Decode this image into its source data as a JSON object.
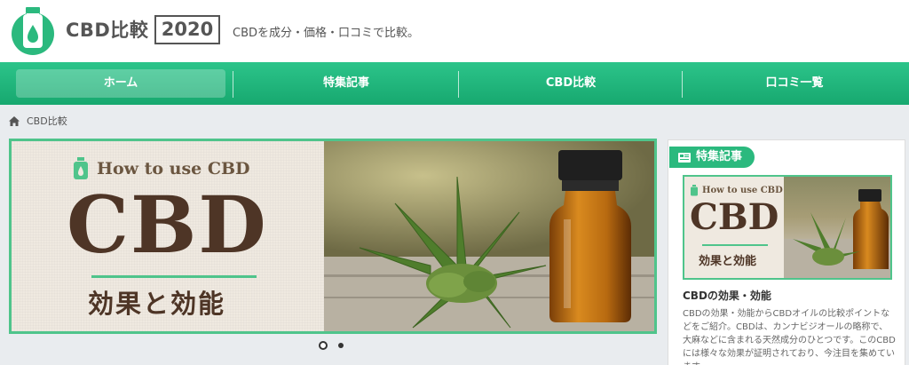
{
  "header": {
    "logo_text": "CBD比較",
    "logo_year": "2020",
    "tagline": "CBDを成分・価格・口コミで比較。"
  },
  "nav": {
    "items": [
      {
        "label": "ホーム",
        "active": true
      },
      {
        "label": "特集記事",
        "active": false
      },
      {
        "label": "CBD比較",
        "active": false
      },
      {
        "label": "口コミ一覧",
        "active": false
      }
    ]
  },
  "breadcrumb": {
    "home_icon": "home-icon",
    "label": "CBD比較"
  },
  "slider": {
    "how_to": "How to use CBD",
    "big_title": "CBD",
    "subtitle": "効果と効能",
    "dots": 2,
    "active_dot": 0
  },
  "sidebar": {
    "section_label": "特集記事",
    "section_icon": "newspaper-icon",
    "thumb": {
      "how_to": "How to use CBD",
      "big_title": "CBD",
      "subtitle": "効果と効能"
    },
    "article_title": "CBDの効果・効能",
    "article_excerpt": "CBDの効果・効能からCBDオイルの比較ポイントなどをご紹介。CBDは、カンナビジオールの略称で、大麻などに含まれる天然成分のひとつです。このCBDには様々な効果が証明されており、今注目を集めています。"
  },
  "colors": {
    "accent": "#2bb97e",
    "nav_green": "#17a86f",
    "brown": "#4e3526"
  }
}
